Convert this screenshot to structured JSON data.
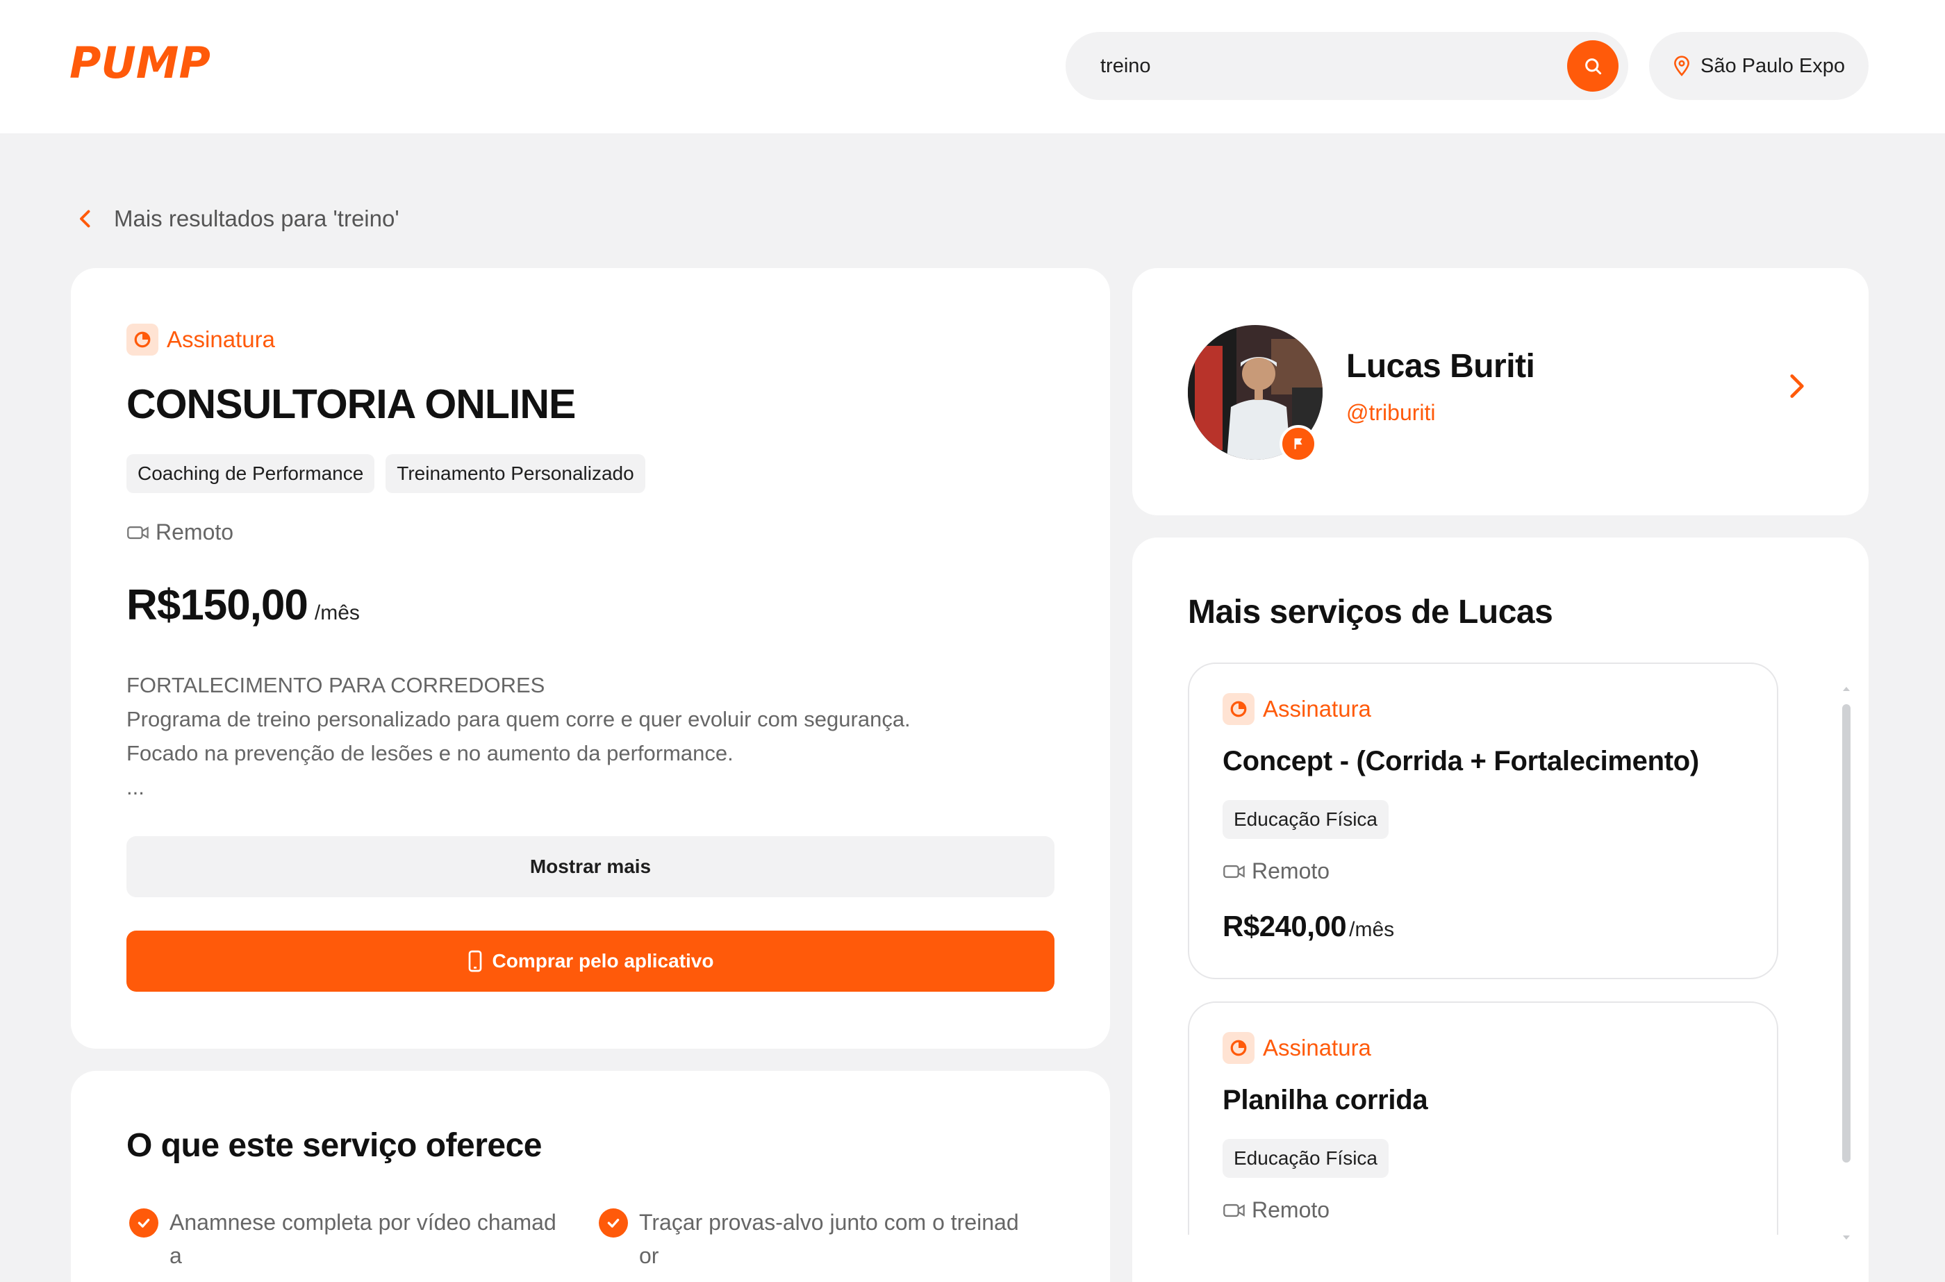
{
  "header": {
    "logo_text": "PUMP",
    "search": {
      "value": "treino",
      "icon": "search-icon"
    },
    "location": {
      "label": "São Paulo Expo",
      "icon": "location-pin-icon"
    },
    "accent_color": "#ff5a0a"
  },
  "breadcrumb": {
    "label": "Mais resultados para 'treino'",
    "icon": "chevron-left-icon"
  },
  "service": {
    "type_label": "Assinatura",
    "title": "CONSULTORIA ONLINE",
    "tags": [
      "Coaching de Performance",
      "Treinamento Personalizado"
    ],
    "mode": "Remoto",
    "price": "R$150,00",
    "price_unit": "/mês",
    "description": [
      "FORTALECIMENTO PARA CORREDORES",
      "Programa de treino personalizado para quem corre e quer evoluir com segurança.",
      "Focado na prevenção de lesões e no aumento da performance.",
      "..."
    ],
    "show_more_label": "Mostrar mais",
    "buy_label": "Comprar pelo aplicativo"
  },
  "offers": {
    "title": "O que este serviço oferece",
    "items": [
      {
        "line1": "Anamnese completa por vídeo chamad",
        "line2": "a"
      },
      {
        "line1": "Traçar provas-alvo junto com o treinad",
        "line2": "or"
      }
    ]
  },
  "professional": {
    "name": "Lucas Buriti",
    "handle": "@triburiti"
  },
  "more_services": {
    "title": "Mais serviços de Lucas",
    "items": [
      {
        "type_label": "Assinatura",
        "title": "Concept - (Corrida + Fortalecimento)",
        "tag": "Educação Física",
        "mode": "Remoto",
        "price": "R$240,00",
        "price_unit": "/mês"
      },
      {
        "type_label": "Assinatura",
        "title": "Planilha corrida",
        "tag": "Educação Física",
        "mode": "Remoto"
      }
    ]
  }
}
